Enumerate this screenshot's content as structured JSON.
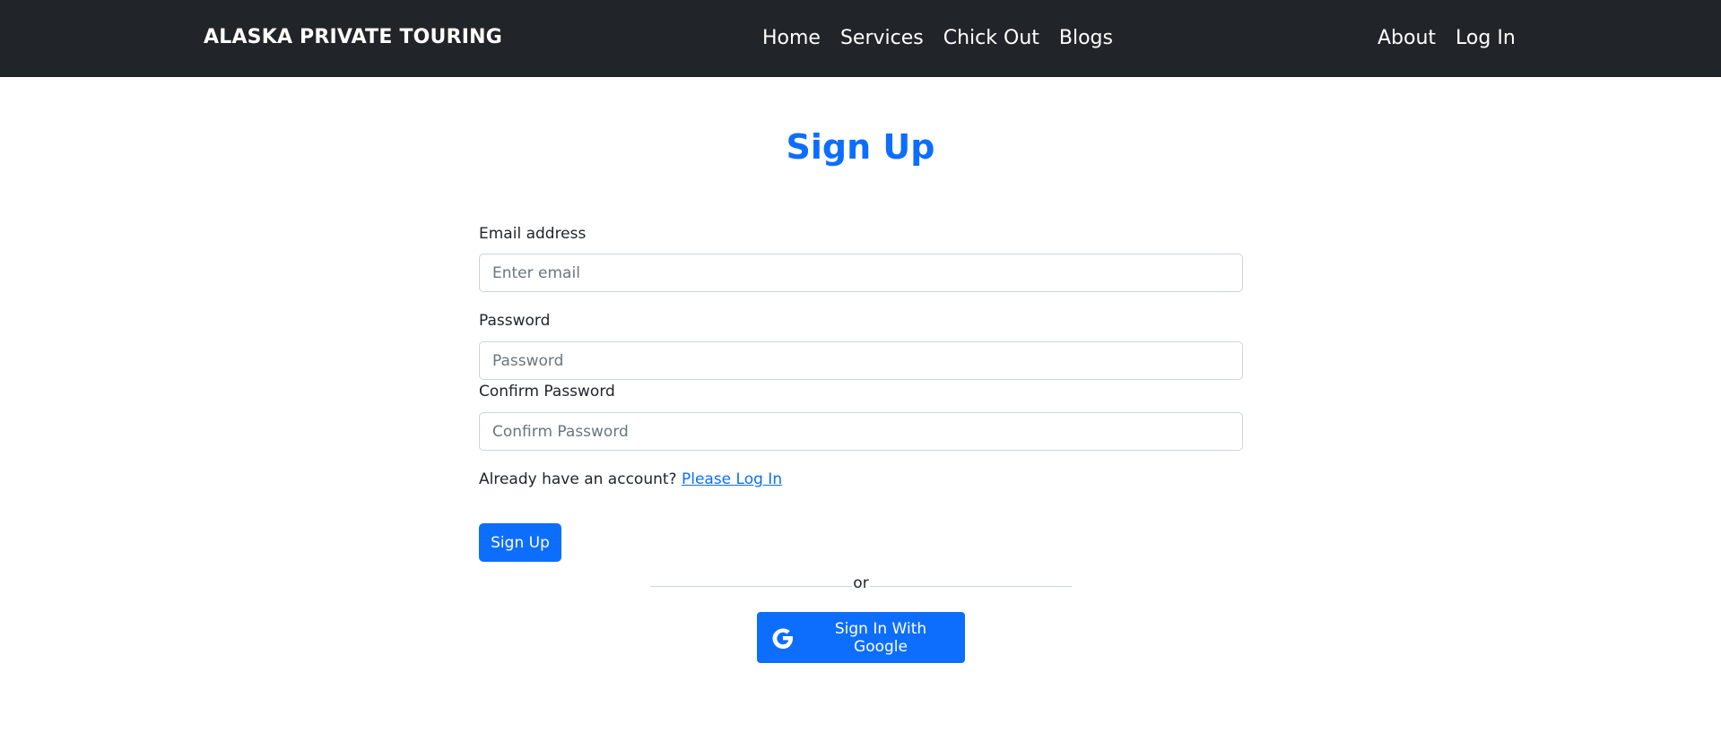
{
  "navbar": {
    "brand": "ALASKA PRIVATE TOURING",
    "center_links": [
      {
        "label": "Home"
      },
      {
        "label": "Services"
      },
      {
        "label": "Chick Out"
      },
      {
        "label": "Blogs"
      }
    ],
    "right_links": [
      {
        "label": "About"
      },
      {
        "label": "Log In"
      }
    ]
  },
  "page": {
    "title": "Sign Up"
  },
  "form": {
    "email": {
      "label": "Email address",
      "placeholder": "Enter email",
      "value": ""
    },
    "password": {
      "label": "Password",
      "placeholder": "Password",
      "value": ""
    },
    "confirm_password": {
      "label": "Confirm Password",
      "placeholder": "Confirm Password",
      "value": ""
    },
    "account_prompt": "Already have an account?",
    "login_link": "Please Log In",
    "submit_label": "Sign Up"
  },
  "divider": {
    "text": "or"
  },
  "google_button": {
    "label": "Sign In With Google",
    "icon": "google-icon"
  },
  "colors": {
    "navbar_bg": "#212529",
    "primary": "#0d6efd",
    "text": "#212529",
    "border": "#ced4da"
  }
}
